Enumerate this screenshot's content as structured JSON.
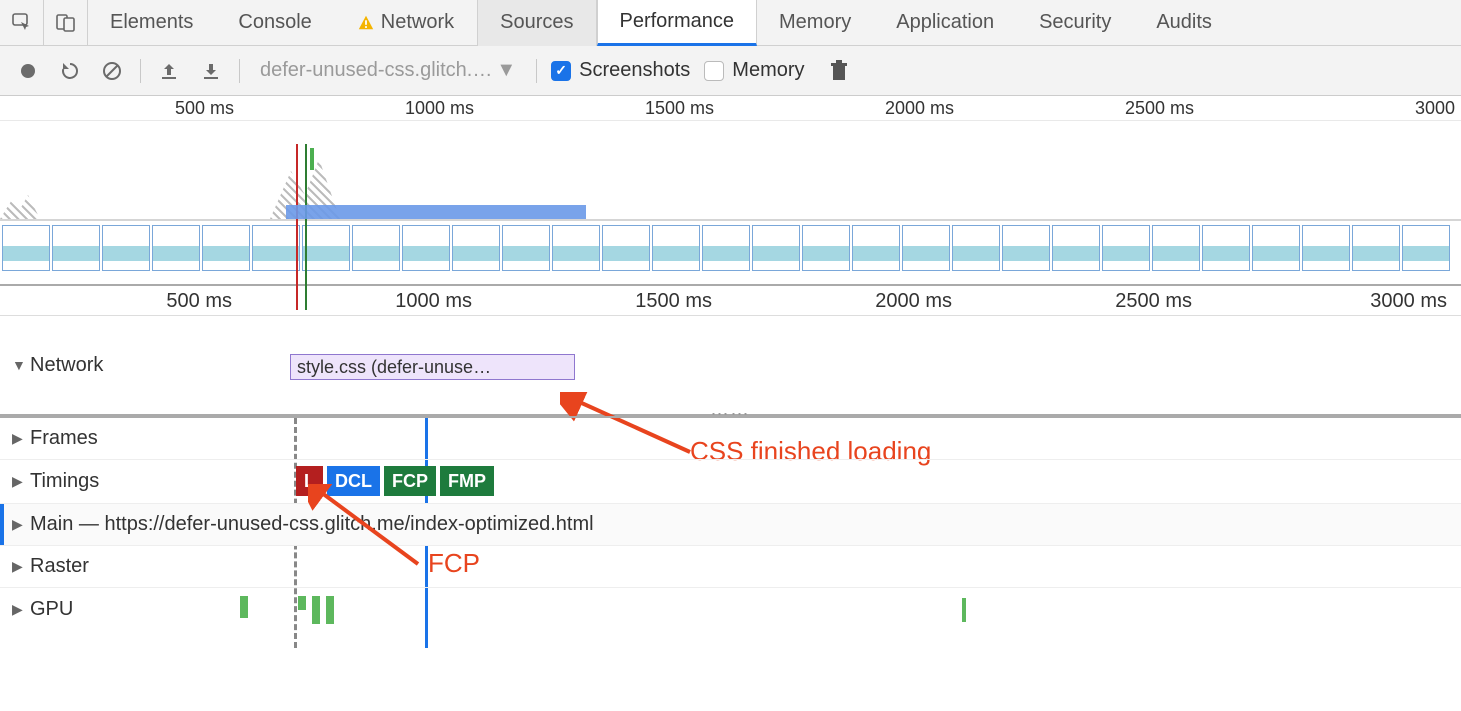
{
  "tabs": {
    "elements": "Elements",
    "console": "Console",
    "network": "Network",
    "sources": "Sources",
    "performance": "Performance",
    "memory": "Memory",
    "application": "Application",
    "security": "Security",
    "audits": "Audits"
  },
  "toolbar": {
    "page_select": "defer-unused-css.glitch.…",
    "screenshots_label": "Screenshots",
    "memory_label": "Memory"
  },
  "ruler": {
    "t500": "500 ms",
    "t1000": "1000 ms",
    "t1500": "1500 ms",
    "t2000": "2000 ms",
    "t2500": "2500 ms",
    "t3000_top": "3000",
    "t3000": "3000 ms"
  },
  "lanes": {
    "network": "Network",
    "frames": "Frames",
    "timings": "Timings",
    "main": "Main — https://defer-unused-css.glitch.me/index-optimized.html",
    "raster": "Raster",
    "gpu": "GPU"
  },
  "network_item": "style.css (defer-unuse…",
  "badges": {
    "l": "L",
    "dcl": "DCL",
    "fcp": "FCP",
    "fmp": "FMP"
  },
  "annotations": {
    "css": "CSS finished loading",
    "fcp": "FCP"
  }
}
